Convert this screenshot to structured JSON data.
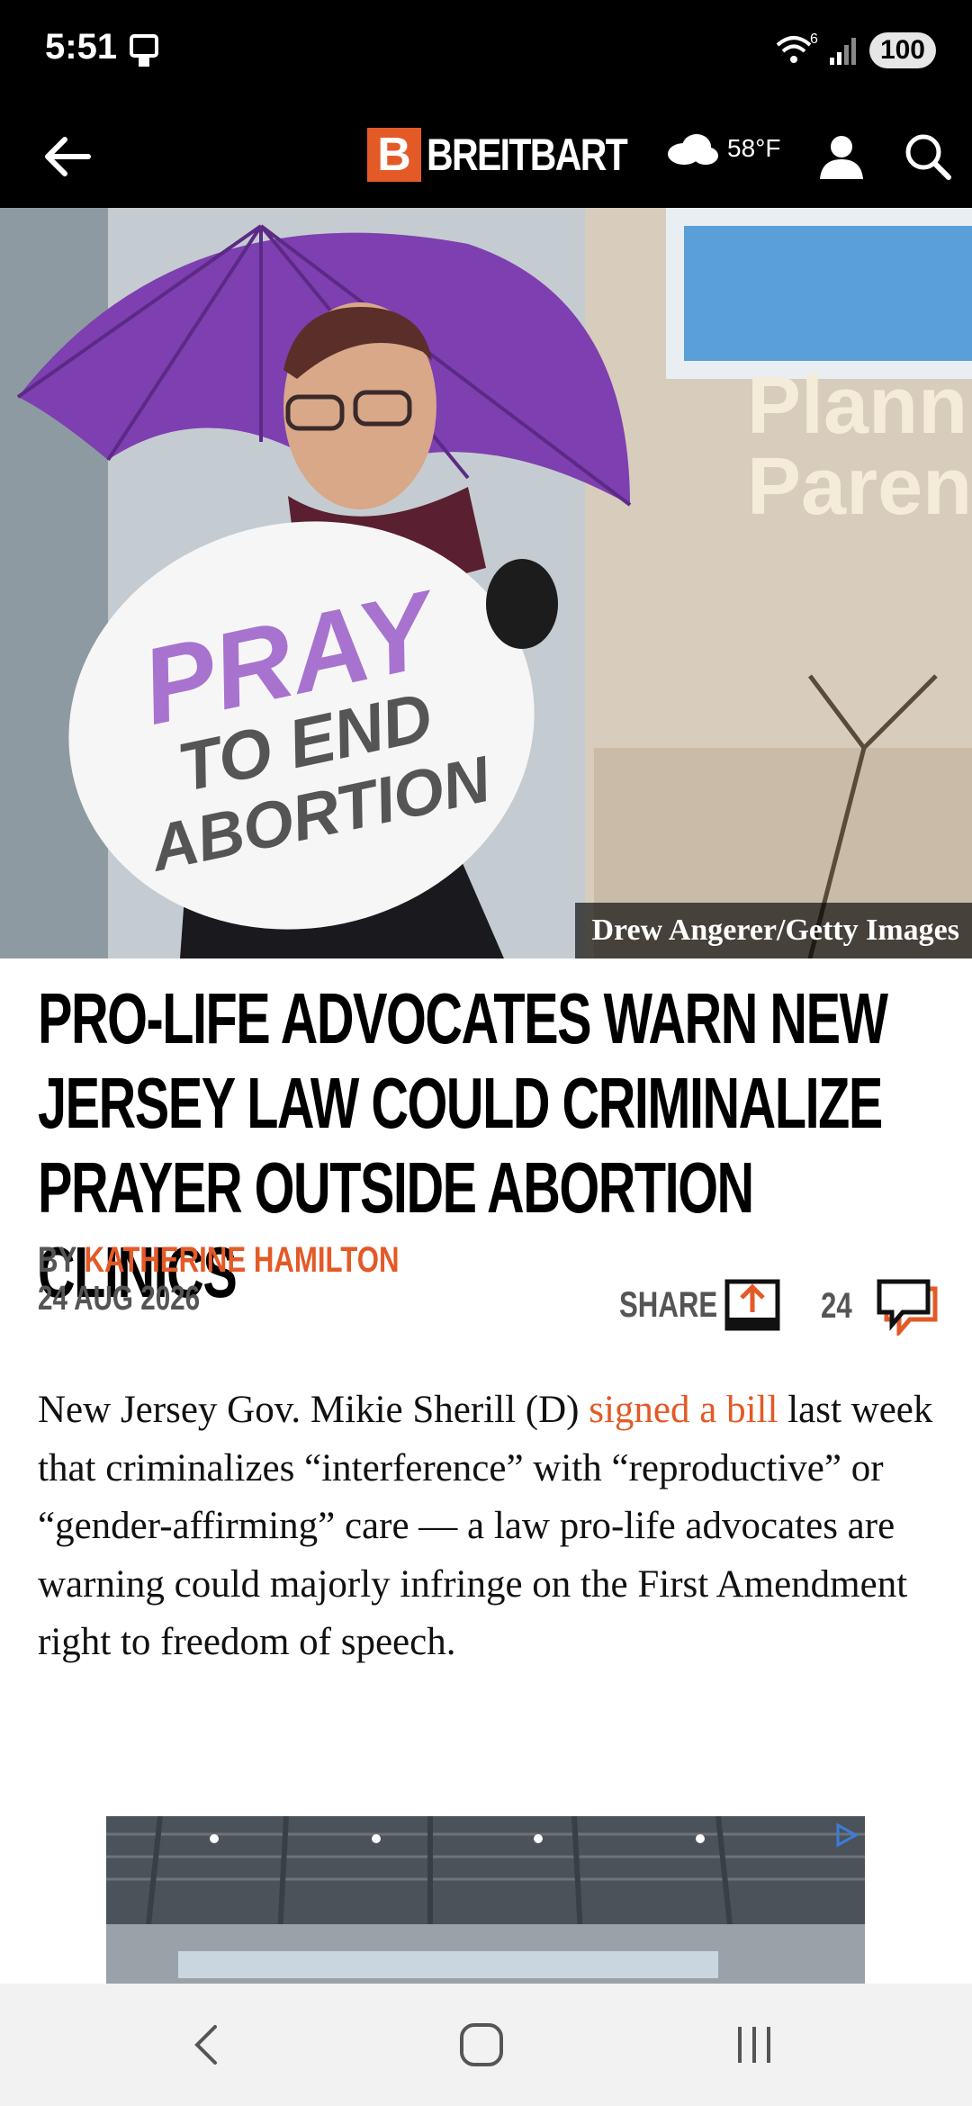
{
  "status_bar": {
    "time": "5:51",
    "wifi_badge": "6",
    "battery": "100"
  },
  "app_bar": {
    "logo_letter": "B",
    "logo_text": "BREITBART",
    "temperature": "58°F",
    "icons": [
      "back-arrow-icon",
      "cloud-icon",
      "user-icon",
      "search-icon"
    ]
  },
  "hero": {
    "sign_line1": "PRAY",
    "sign_line2": "TO END",
    "sign_line3": "ABORTION",
    "credit": "Drew Angerer/Getty Images"
  },
  "article": {
    "headline": "Pro-Life Advocates Warn New Jersey Law Could Criminalize Prayer Outside Abortion Clinics",
    "by_label": "BY",
    "author": "KATHERINE HAMILTON",
    "date": "24 AUG 2026",
    "share_label": "SHARE",
    "comment_count": "24",
    "body_before_link": "New Jersey Gov. Mikie Sherill (D) ",
    "body_link": "signed a bill",
    "body_after_link": " last week that criminalizes “interference” with “reproductive” or “gender-affirming” care — a law pro-life advocates are warning could majorly infringe on the First Amendment right to freedom of speech."
  },
  "colors": {
    "brand": "#e35a27",
    "header_bg": "#000000"
  }
}
